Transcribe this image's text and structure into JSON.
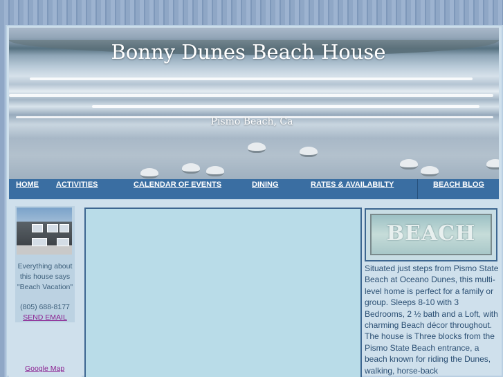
{
  "header": {
    "title": "Bonny Dunes Beach House",
    "subtitle": "Pismo Beach, Ca"
  },
  "nav": {
    "items": [
      {
        "label": "HOME"
      },
      {
        "label": "ACTIVITIES"
      },
      {
        "label": "CALENDAR OF EVENTS"
      },
      {
        "label": "DINING"
      },
      {
        "label": "RATES & AVAILABILTY"
      },
      {
        "label": "BEACH BLOG"
      }
    ]
  },
  "sidebar": {
    "tagline": "Everything about this house says \"Beach Vacation\"",
    "phone": "(805) 688-8177",
    "email_link": "SEND EMAIL",
    "map_link": "Google Map"
  },
  "right": {
    "sign_text": "BEACH",
    "description": "Situated just steps from Pismo State Beach at Oceano Dunes, this multi-level home is perfect for a family or group.  Sleeps 8-10 with 3 Bedrooms, 2 ½ bath and a Loft, with charming Beach décor throughout. The house is Three blocks from the Pismo State Beach entrance, a beach known for riding the Dunes, walking, horse-back"
  },
  "colors": {
    "nav_bg": "#3a6ea2",
    "link_visited": "#8a1d8f",
    "text": "#2b4f73"
  }
}
